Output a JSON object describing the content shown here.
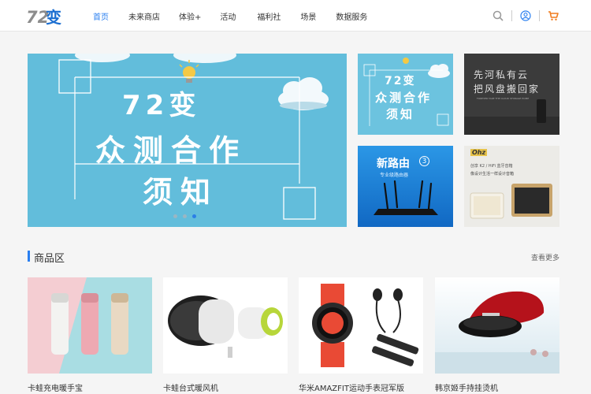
{
  "header": {
    "logo_text": "72变",
    "nav": [
      {
        "label": "首页",
        "active": true
      },
      {
        "label": "未来商店",
        "active": false
      },
      {
        "label": "体验+",
        "active": false
      },
      {
        "label": "活动",
        "active": false
      },
      {
        "label": "福利社",
        "active": false
      },
      {
        "label": "场景",
        "active": false
      },
      {
        "label": "数据服务",
        "active": false
      }
    ],
    "icons": [
      "search-icon",
      "user-icon",
      "cart-icon"
    ]
  },
  "banner": {
    "line1": "72变",
    "line2": "众测合作",
    "line3": "须知",
    "slide_count": 3,
    "active_slide": 3
  },
  "tiles": {
    "t1": {
      "line1": "72变",
      "line2": "众测合作",
      "line3": "须知"
    },
    "t2": {
      "line1": "先河私有云",
      "line2": "把风盘搬回家",
      "sub": "FOREVER TAKE THE CLOUD STORAGE HOME"
    },
    "t3": {
      "title": "新路由",
      "num": "3",
      "sub": "专业级路由器"
    },
    "t4": {
      "brand": "Ohz",
      "line1": "创享 K2 / HiFi 蓝牙音箱",
      "line2": "像设计生活一样设计音箱"
    }
  },
  "section": {
    "title": "商品区",
    "more": "查看更多"
  },
  "products": [
    {
      "name": "卡蛙充电暖手宝"
    },
    {
      "name": "卡蛙台式暖风机"
    },
    {
      "name": "华米AMAZFIT运动手表冠军版"
    },
    {
      "name": "韩京姬手持挂烫机"
    }
  ],
  "colors": {
    "accent": "#2a7ff0",
    "cart": "#f07c1e",
    "banner_bg": "#64bfdb"
  }
}
